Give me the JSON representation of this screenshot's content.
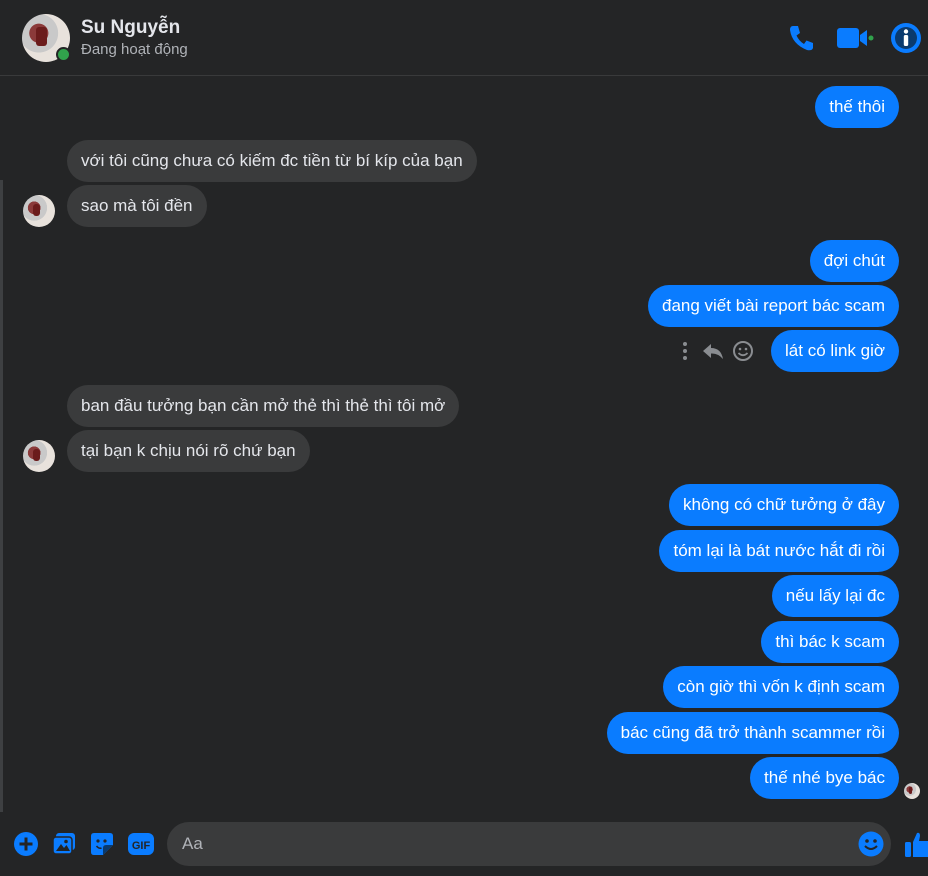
{
  "header": {
    "contact_name": "Su Nguyễn",
    "status": "Đang hoạt động"
  },
  "messages": [
    {
      "direction": "out",
      "text": "thế thôi"
    },
    {
      "direction": "in",
      "text": "với tôi cũng chưa có kiếm đc tiền từ bí kíp của bạn"
    },
    {
      "direction": "in",
      "text": "sao mà tôi đền"
    },
    {
      "direction": "out",
      "text": "đợi chút"
    },
    {
      "direction": "out",
      "text": "đang viết bài report bác scam"
    },
    {
      "direction": "out",
      "text": "lát có link giờ"
    },
    {
      "direction": "in",
      "text": "ban đầu tưởng bạn cần mở thẻ thì thẻ thì tôi mở"
    },
    {
      "direction": "in",
      "text": "tại bạn k chịu nói rõ chứ bạn"
    },
    {
      "direction": "out",
      "text": "không có chữ tưởng ở đây"
    },
    {
      "direction": "out",
      "text": "tóm lại là bát nước hắt đi rồi"
    },
    {
      "direction": "out",
      "text": "nếu lấy lại đc"
    },
    {
      "direction": "out",
      "text": "thì bác k scam"
    },
    {
      "direction": "out",
      "text": "còn giờ thì vốn k định scam"
    },
    {
      "direction": "out",
      "text": "bác cũng đã trở thành scammer rồi"
    },
    {
      "direction": "out",
      "text": "thế nhé bye bác"
    }
  ],
  "composer": {
    "placeholder": "Aa"
  },
  "colors": {
    "accent": "#0a7cff",
    "background": "#242526",
    "incoming_bubble": "#3a3b3c",
    "online": "#31a24c"
  },
  "icons": [
    "phone-icon",
    "video-icon",
    "info-icon",
    "more-icon",
    "reply-icon",
    "react-icon",
    "plus-icon",
    "image-icon",
    "sticker-icon",
    "gif-icon",
    "emoji-icon",
    "like-icon"
  ]
}
